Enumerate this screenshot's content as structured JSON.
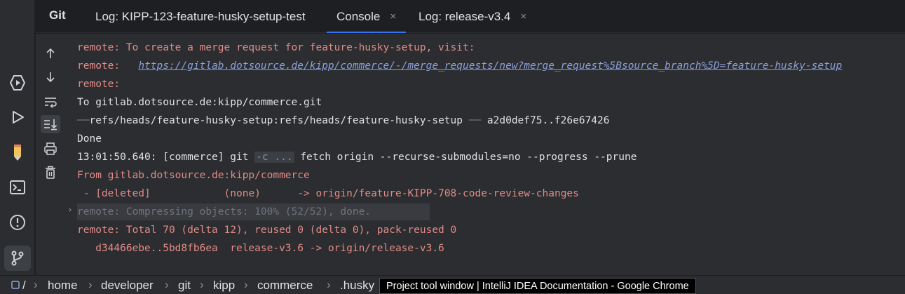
{
  "tool_window": {
    "title": "Git",
    "tabs": [
      {
        "label": "Log: KIPP-123-feature-husky-setup-test",
        "closable": false,
        "active": false
      },
      {
        "label": "Console",
        "closable": true,
        "active": true
      },
      {
        "label": "Log: release-v3.4",
        "closable": true,
        "active": false
      }
    ],
    "close_glyph": "×"
  },
  "left_strip_icons": [
    "services-icon",
    "run-icon",
    "bookmark-pencil-icon",
    "terminal-icon",
    "problems-icon",
    "git-icon"
  ],
  "console_toolbar_icons": [
    "scroll-up-icon",
    "scroll-down-icon",
    "soft-wrap-icon",
    "scroll-to-end-icon",
    "print-icon",
    "trash-icon"
  ],
  "console": {
    "l1": "remote: To create a merge request for feature-husky-setup, visit:",
    "l2_prefix": "remote:   ",
    "l2_link": "https://gitlab.dotsource.de/kipp/commerce/-/merge_requests/new?merge_request%5Bsource_branch%5D=feature-husky-setup",
    "l3": "remote:",
    "l4": "To gitlab.dotsource.de:kipp/commerce.git",
    "l5_ref": "refs/heads/feature-husky-setup:refs/heads/feature-husky-setup",
    "l5_range": "a2d0def75..f26e67426",
    "l6": "Done",
    "l7_prefix": "13:01:50.640: [commerce] git ",
    "l7_chip": "-c ...",
    "l7_suffix": " fetch origin --recurse-submodules=no --progress --prune",
    "l8": "From gitlab.dotsource.de:kipp/commerce",
    "l9_a": " - [deleted]",
    "l9_b": "(none)",
    "l9_c": "-> origin/feature-KIPP-708-code-review-changes",
    "l10": "remote: Compressing objects: 100% (52/52), done.",
    "l11": "remote: Total 70 (delta 12), reused 0 (delta 0), pack-reused 0",
    "l12": "   d34466ebe..5bd8fb6ea  release-v3.6 -> origin/release-v3.6"
  },
  "breadcrumbs": [
    "/",
    "home",
    "developer",
    "git",
    "kipp",
    "commerce",
    ".husky"
  ],
  "breadcrumb_sep": "›",
  "tooltip": "Project tool window | IntelliJ IDEA Documentation - Google Chrome",
  "colors": {
    "accent": "#3574f0",
    "remote_text": "#e38b87",
    "link": "#8c9fd8"
  }
}
